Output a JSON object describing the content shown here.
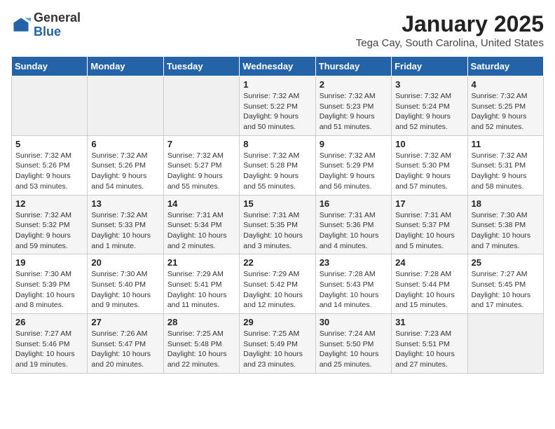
{
  "logo": {
    "general": "General",
    "blue": "Blue"
  },
  "title": "January 2025",
  "subtitle": "Tega Cay, South Carolina, United States",
  "days_of_week": [
    "Sunday",
    "Monday",
    "Tuesday",
    "Wednesday",
    "Thursday",
    "Friday",
    "Saturday"
  ],
  "weeks": [
    [
      {
        "day": "",
        "info": ""
      },
      {
        "day": "",
        "info": ""
      },
      {
        "day": "",
        "info": ""
      },
      {
        "day": "1",
        "info": "Sunrise: 7:32 AM\nSunset: 5:22 PM\nDaylight: 9 hours\nand 50 minutes."
      },
      {
        "day": "2",
        "info": "Sunrise: 7:32 AM\nSunset: 5:23 PM\nDaylight: 9 hours\nand 51 minutes."
      },
      {
        "day": "3",
        "info": "Sunrise: 7:32 AM\nSunset: 5:24 PM\nDaylight: 9 hours\nand 52 minutes."
      },
      {
        "day": "4",
        "info": "Sunrise: 7:32 AM\nSunset: 5:25 PM\nDaylight: 9 hours\nand 52 minutes."
      }
    ],
    [
      {
        "day": "5",
        "info": "Sunrise: 7:32 AM\nSunset: 5:26 PM\nDaylight: 9 hours\nand 53 minutes."
      },
      {
        "day": "6",
        "info": "Sunrise: 7:32 AM\nSunset: 5:26 PM\nDaylight: 9 hours\nand 54 minutes."
      },
      {
        "day": "7",
        "info": "Sunrise: 7:32 AM\nSunset: 5:27 PM\nDaylight: 9 hours\nand 55 minutes."
      },
      {
        "day": "8",
        "info": "Sunrise: 7:32 AM\nSunset: 5:28 PM\nDaylight: 9 hours\nand 55 minutes."
      },
      {
        "day": "9",
        "info": "Sunrise: 7:32 AM\nSunset: 5:29 PM\nDaylight: 9 hours\nand 56 minutes."
      },
      {
        "day": "10",
        "info": "Sunrise: 7:32 AM\nSunset: 5:30 PM\nDaylight: 9 hours\nand 57 minutes."
      },
      {
        "day": "11",
        "info": "Sunrise: 7:32 AM\nSunset: 5:31 PM\nDaylight: 9 hours\nand 58 minutes."
      }
    ],
    [
      {
        "day": "12",
        "info": "Sunrise: 7:32 AM\nSunset: 5:32 PM\nDaylight: 9 hours\nand 59 minutes."
      },
      {
        "day": "13",
        "info": "Sunrise: 7:32 AM\nSunset: 5:33 PM\nDaylight: 10 hours\nand 1 minute."
      },
      {
        "day": "14",
        "info": "Sunrise: 7:31 AM\nSunset: 5:34 PM\nDaylight: 10 hours\nand 2 minutes."
      },
      {
        "day": "15",
        "info": "Sunrise: 7:31 AM\nSunset: 5:35 PM\nDaylight: 10 hours\nand 3 minutes."
      },
      {
        "day": "16",
        "info": "Sunrise: 7:31 AM\nSunset: 5:36 PM\nDaylight: 10 hours\nand 4 minutes."
      },
      {
        "day": "17",
        "info": "Sunrise: 7:31 AM\nSunset: 5:37 PM\nDaylight: 10 hours\nand 5 minutes."
      },
      {
        "day": "18",
        "info": "Sunrise: 7:30 AM\nSunset: 5:38 PM\nDaylight: 10 hours\nand 7 minutes."
      }
    ],
    [
      {
        "day": "19",
        "info": "Sunrise: 7:30 AM\nSunset: 5:39 PM\nDaylight: 10 hours\nand 8 minutes."
      },
      {
        "day": "20",
        "info": "Sunrise: 7:30 AM\nSunset: 5:40 PM\nDaylight: 10 hours\nand 9 minutes."
      },
      {
        "day": "21",
        "info": "Sunrise: 7:29 AM\nSunset: 5:41 PM\nDaylight: 10 hours\nand 11 minutes."
      },
      {
        "day": "22",
        "info": "Sunrise: 7:29 AM\nSunset: 5:42 PM\nDaylight: 10 hours\nand 12 minutes."
      },
      {
        "day": "23",
        "info": "Sunrise: 7:28 AM\nSunset: 5:43 PM\nDaylight: 10 hours\nand 14 minutes."
      },
      {
        "day": "24",
        "info": "Sunrise: 7:28 AM\nSunset: 5:44 PM\nDaylight: 10 hours\nand 15 minutes."
      },
      {
        "day": "25",
        "info": "Sunrise: 7:27 AM\nSunset: 5:45 PM\nDaylight: 10 hours\nand 17 minutes."
      }
    ],
    [
      {
        "day": "26",
        "info": "Sunrise: 7:27 AM\nSunset: 5:46 PM\nDaylight: 10 hours\nand 19 minutes."
      },
      {
        "day": "27",
        "info": "Sunrise: 7:26 AM\nSunset: 5:47 PM\nDaylight: 10 hours\nand 20 minutes."
      },
      {
        "day": "28",
        "info": "Sunrise: 7:25 AM\nSunset: 5:48 PM\nDaylight: 10 hours\nand 22 minutes."
      },
      {
        "day": "29",
        "info": "Sunrise: 7:25 AM\nSunset: 5:49 PM\nDaylight: 10 hours\nand 23 minutes."
      },
      {
        "day": "30",
        "info": "Sunrise: 7:24 AM\nSunset: 5:50 PM\nDaylight: 10 hours\nand 25 minutes."
      },
      {
        "day": "31",
        "info": "Sunrise: 7:23 AM\nSunset: 5:51 PM\nDaylight: 10 hours\nand 27 minutes."
      },
      {
        "day": "",
        "info": ""
      }
    ]
  ]
}
